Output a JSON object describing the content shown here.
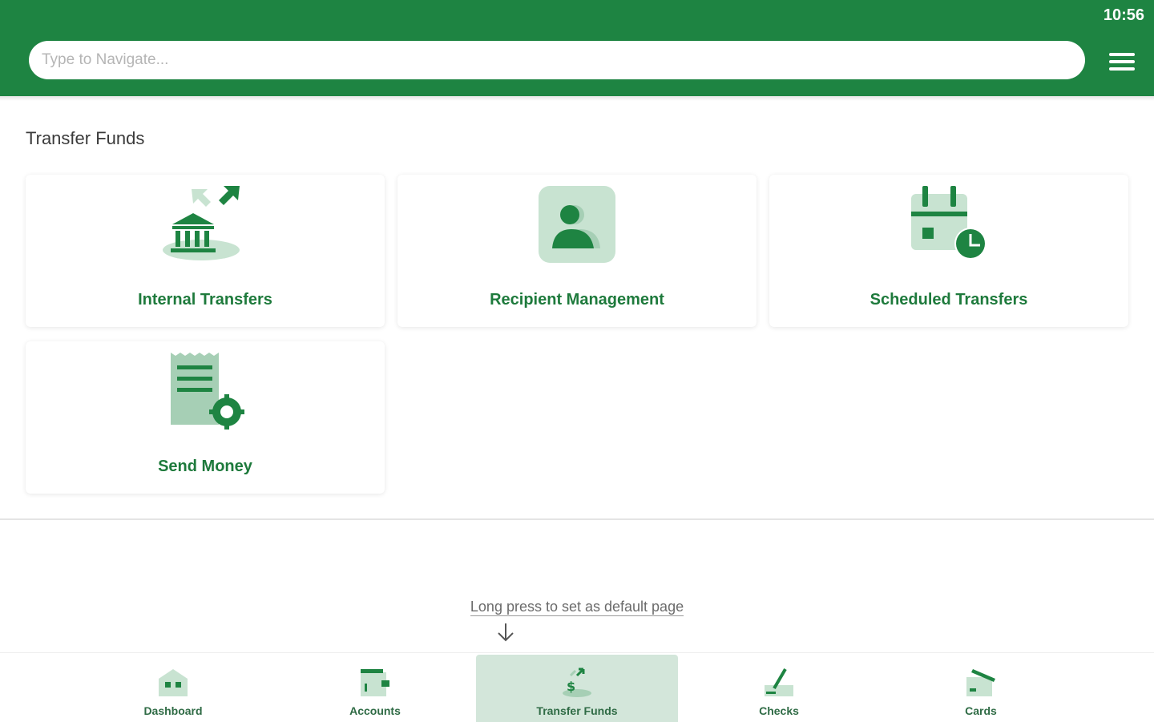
{
  "header": {
    "time": "10:56",
    "search_placeholder": "Type to Navigate..."
  },
  "section_title": "Transfer Funds",
  "cards": [
    {
      "label": "Internal Transfers",
      "icon": "bank-transfer-icon"
    },
    {
      "label": "Recipient Management",
      "icon": "recipient-icon"
    },
    {
      "label": "Scheduled Transfers",
      "icon": "calendar-clock-icon"
    },
    {
      "label": "Send Money",
      "icon": "receipt-gear-icon"
    }
  ],
  "hint": "Long press to set as default page",
  "bottom_nav": [
    {
      "label": "Dashboard",
      "icon": "dashboard-icon",
      "active": false
    },
    {
      "label": "Accounts",
      "icon": "wallet-icon",
      "active": false
    },
    {
      "label": "Transfer Funds",
      "icon": "transfer-funds-icon",
      "active": true
    },
    {
      "label": "Checks",
      "icon": "check-icon",
      "active": false
    },
    {
      "label": "Cards",
      "icon": "cards-icon",
      "active": false
    }
  ],
  "colors": {
    "primary": "#1e8442",
    "light_green": "#c8e3d1",
    "active_nav_bg": "#d3e6da"
  }
}
